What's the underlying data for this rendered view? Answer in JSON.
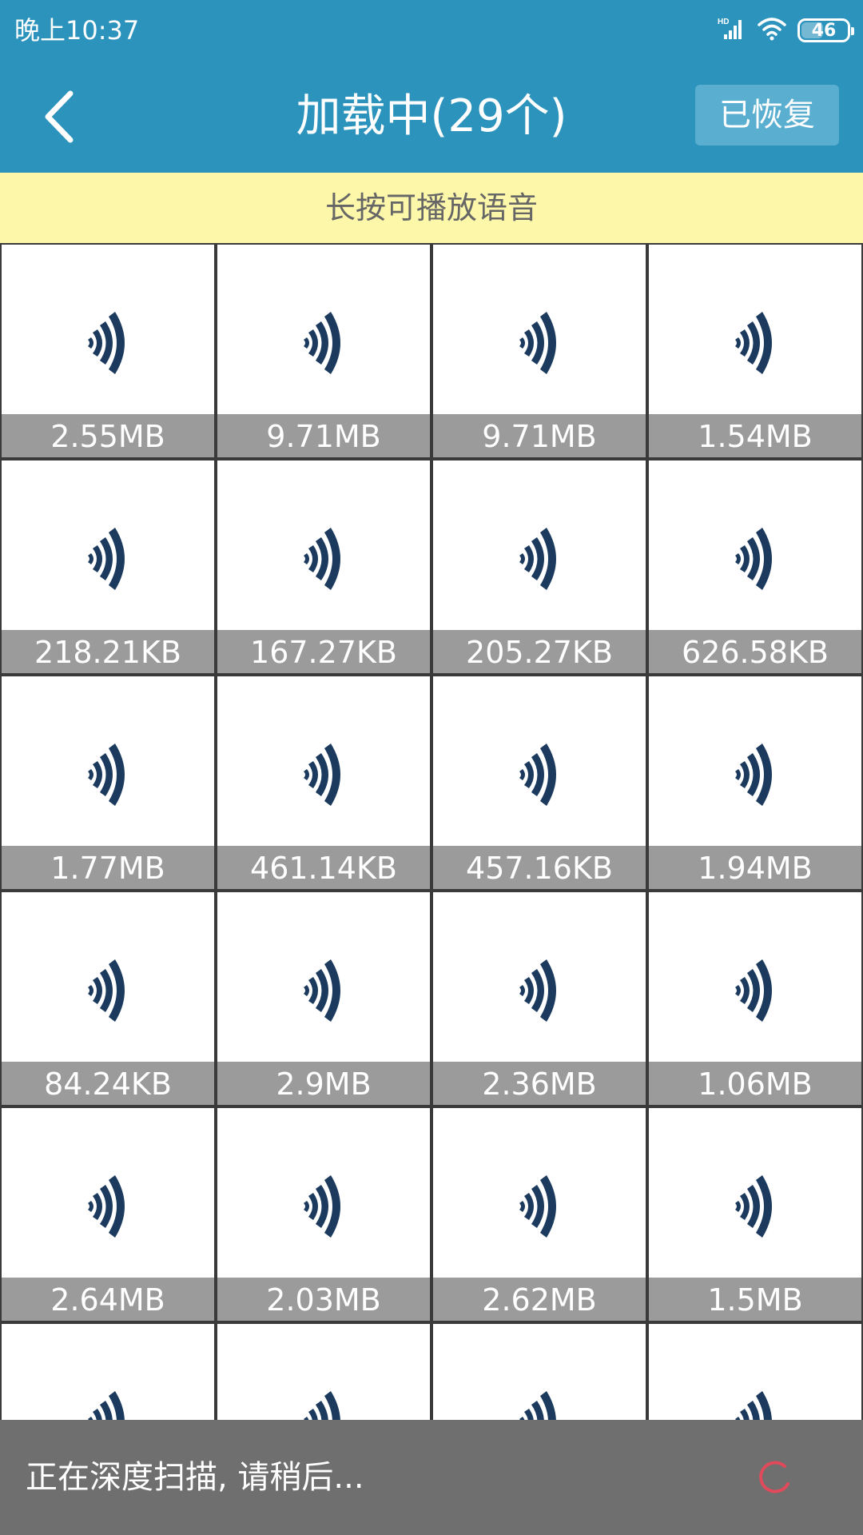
{
  "status_bar": {
    "time": "晚上10:37",
    "signal_label": "HD",
    "battery": "46",
    "battery_level_percent": 46
  },
  "header": {
    "title": "加载中(29个)",
    "restored_button": "已恢复"
  },
  "hint": "长按可播放语音",
  "grid": {
    "items": [
      {
        "size": "2.55MB"
      },
      {
        "size": "9.71MB"
      },
      {
        "size": "9.71MB"
      },
      {
        "size": "1.54MB"
      },
      {
        "size": "218.21KB"
      },
      {
        "size": "167.27KB"
      },
      {
        "size": "205.27KB"
      },
      {
        "size": "626.58KB"
      },
      {
        "size": "1.77MB"
      },
      {
        "size": "461.14KB"
      },
      {
        "size": "457.16KB"
      },
      {
        "size": "1.94MB"
      },
      {
        "size": "84.24KB"
      },
      {
        "size": "2.9MB"
      },
      {
        "size": "2.36MB"
      },
      {
        "size": "1.06MB"
      },
      {
        "size": "2.64MB"
      },
      {
        "size": "2.03MB"
      },
      {
        "size": "2.62MB"
      },
      {
        "size": "1.5MB"
      },
      {
        "size": ""
      },
      {
        "size": ""
      },
      {
        "size": ""
      },
      {
        "size": ""
      }
    ]
  },
  "loading": {
    "message": "正在深度扫描, 请稍后...",
    "spinner_color": "#e04a5a"
  },
  "colors": {
    "primary": "#2c93bd",
    "hint_bg": "#fdf7aa",
    "icon": "#1b3a5e"
  }
}
